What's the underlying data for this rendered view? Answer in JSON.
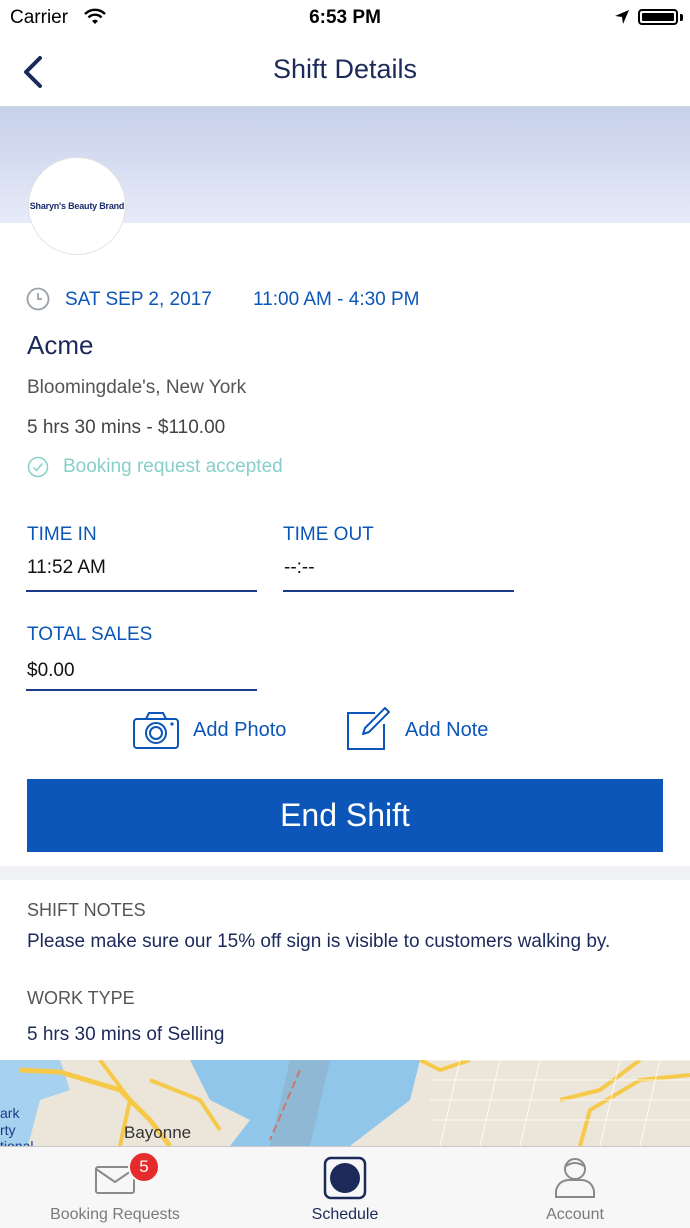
{
  "status_bar": {
    "carrier": "Carrier",
    "time": "6:53 PM"
  },
  "nav": {
    "title": "Shift Details"
  },
  "brand": {
    "logo_text": "Sharyn's Beauty Brand"
  },
  "shift": {
    "date": "SAT SEP 2, 2017",
    "hours": "11:00 AM - 4:30 PM",
    "company": "Acme",
    "location": "Bloomingdale's, New York",
    "duration_pay": "5 hrs 30 mins - $110.00",
    "status": "Booking request accepted"
  },
  "fields": {
    "time_in_label": "TIME IN",
    "time_in_value": "11:52 AM",
    "time_out_label": "TIME OUT",
    "time_out_value": "--:--",
    "total_sales_label": "TOTAL SALES",
    "total_sales_value": "$0.00"
  },
  "actions": {
    "add_photo": "Add Photo",
    "add_note": "Add Note",
    "end_shift": "End Shift"
  },
  "details": {
    "notes_label": "SHIFT NOTES",
    "notes_text": "Please make sure our 15% off sign is visible to customers walking by.",
    "work_type_label": "WORK TYPE",
    "work_type_text": "5 hrs 30 mins of Selling"
  },
  "map": {
    "place_label": "Bayonne",
    "edge_labels": [
      "ark",
      "rty",
      "tional"
    ]
  },
  "tabs": [
    {
      "label": "Booking Requests",
      "badge": "5",
      "icon": "envelope-icon",
      "active": false
    },
    {
      "label": "Schedule",
      "icon": "schedule-icon",
      "active": true
    },
    {
      "label": "Account",
      "icon": "person-icon",
      "active": false
    }
  ],
  "colors": {
    "primary": "#0b56b8",
    "navy": "#1c2a5a",
    "accepted": "#86cfca",
    "badge": "#e52b2b"
  }
}
